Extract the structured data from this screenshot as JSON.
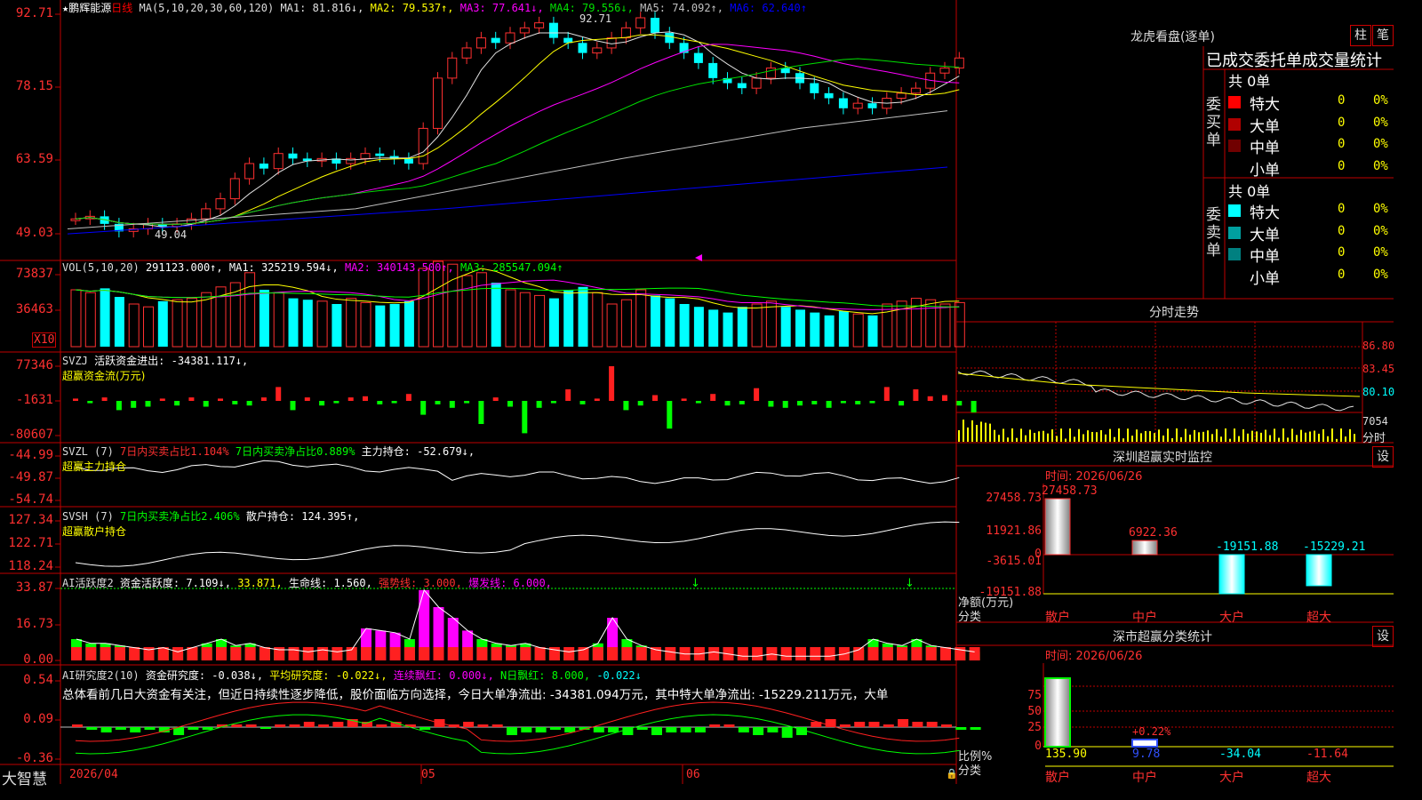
{
  "stock": {
    "star": "★",
    "name": "鹏辉能源",
    "period": "日线",
    "ma_header": "MA(5,10,20,30,60,120)",
    "ma": [
      {
        "label": "MA1: 81.816↓,",
        "color": "#e0e0e0"
      },
      {
        "label": "MA2: 79.537↑,",
        "color": "#ffff00"
      },
      {
        "label": "MA3: 77.641↓,",
        "color": "#ff00ff"
      },
      {
        "label": "MA4: 79.556↓,",
        "color": "#00e000"
      },
      {
        "label": "MA5: 74.092↑,",
        "color": "#c0c0c0"
      },
      {
        "label": "MA6: 62.640↑",
        "color": "#0000ff"
      }
    ],
    "high_label": "92.71",
    "low_label": "49.04",
    "y_ticks": [
      "92.71",
      "78.15",
      "63.59",
      "49.03"
    ]
  },
  "vol": {
    "title": "VOL(5,10,20)",
    "value": "291123.000↑,",
    "ma1": "MA1: 325219.594↓,",
    "ma2": "MA2: 340143.500↑,",
    "ma3": "MA3: 285547.094↑",
    "y_ticks": [
      "73837",
      "36463"
    ],
    "unit": "X10"
  },
  "svzj": {
    "title": "SVZJ",
    "label": "活跃资金进出: -34381.117↓,",
    "sub": "超赢资金流(万元)",
    "y_ticks": [
      "77346",
      "-1631",
      "-80607"
    ]
  },
  "svzl": {
    "title": "SVZL (7)",
    "a": "7日内买卖占比1.104%",
    "b": "7日内买卖净占比0.889%",
    "c": "主力持仓: -52.679↓,",
    "sub": "超赢主力持仓",
    "y_ticks": [
      "-44.99",
      "-49.87",
      "-54.74"
    ]
  },
  "svsh": {
    "title": "SVSH (7)",
    "a": "7日内买卖净占比2.406%",
    "b": "散户持仓: 124.395↑,",
    "sub": "超赢散户持仓",
    "y_ticks": [
      "127.34",
      "122.71",
      "118.24"
    ]
  },
  "ai1": {
    "title": "AI活跃度2",
    "a": "资金活跃度: 7.109↓,",
    "b": "33.871,",
    "c": "生命线: 1.560,",
    "d": "强势线: 3.000,",
    "e": "爆发线: 6.000,",
    "y_ticks": [
      "33.87",
      "16.73",
      "0.00"
    ]
  },
  "ai2": {
    "title": "AI研究度2(10)",
    "a": "资金研究度: -0.038↓,",
    "b": "平均研究度: -0.022↓,",
    "c": "连续飘红: 0.000↓,",
    "d": "N日飘红: 8.000,",
    "e": "-0.022↓",
    "note": "总体看前几日大资金有关注，但近日持续性逐步降低，股价面临方向选择，今日大单净流出: -34381.094万元，其中特大单净流出: -15229.211万元，大单",
    "y_ticks": [
      "0.54",
      "0.09",
      "-0.36"
    ]
  },
  "xaxis": {
    "start": "2026/04",
    "m1": "05",
    "m2": "06"
  },
  "brand": "大智慧",
  "lhb": {
    "title": "龙虎看盘(逐单)",
    "btn1": "柱",
    "btn2": "笔",
    "header": "已成交委托单成交量统计",
    "buy": {
      "side": "委买单",
      "total": "共 0单",
      "rows": [
        {
          "k": "特大",
          "v": "0",
          "p": "0%",
          "c": "#ff0000"
        },
        {
          "k": "大单",
          "v": "0",
          "p": "0%",
          "c": "#b00000"
        },
        {
          "k": "中单",
          "v": "0",
          "p": "0%",
          "c": "#700000"
        },
        {
          "k": "小单",
          "v": "0",
          "p": "0%",
          "c": "#000"
        }
      ]
    },
    "sell": {
      "side": "委卖单",
      "total": "共 0单",
      "rows": [
        {
          "k": "特大",
          "v": "0",
          "p": "0%",
          "c": "#00ffff"
        },
        {
          "k": "大单",
          "v": "0",
          "p": "0%",
          "c": "#00a0a0"
        },
        {
          "k": "中单",
          "v": "0",
          "p": "0%",
          "c": "#008080"
        },
        {
          "k": "小单",
          "v": "0",
          "p": "0%",
          "c": "#000"
        }
      ]
    }
  },
  "fenshi": {
    "title": "分时走势",
    "y": [
      "86.80",
      "83.45",
      "80.10"
    ],
    "vol": "7054",
    "vol_label": "分时"
  },
  "monitor": {
    "title": "深圳超赢实时监控",
    "btn": "设",
    "time": "时间: 2026/06/26",
    "y": [
      "27458.73",
      "11921.86",
      "0",
      "-3615.01",
      "-19151.88"
    ],
    "ylabel1": "净额(万元)",
    "ylabel2": "分类",
    "bars": [
      {
        "cat": "散户",
        "val": "27458.73"
      },
      {
        "cat": "中户",
        "val": "6922.36"
      },
      {
        "cat": "大户",
        "val": "-19151.88"
      },
      {
        "cat": "超大",
        "val": "-15229.21"
      }
    ]
  },
  "stat": {
    "title": "深市超赢分类统计",
    "btn": "设",
    "time": "时间: 2026/06/26",
    "y": [
      "75",
      "50",
      "25",
      "0"
    ],
    "ylabel1": "比例%",
    "ylabel2": "分类",
    "bars": [
      {
        "cat": "散户",
        "val": "135.90",
        "c": "#ffff00"
      },
      {
        "cat": "中户",
        "val": "9.78",
        "c": "#3050ff"
      },
      {
        "cat": "大户",
        "val": "-34.04",
        "c": "#00ffff"
      },
      {
        "cat": "超大",
        "val": "-11.64",
        "c": "#ff3030"
      }
    ],
    "mid_label": "+0.22%"
  }
}
